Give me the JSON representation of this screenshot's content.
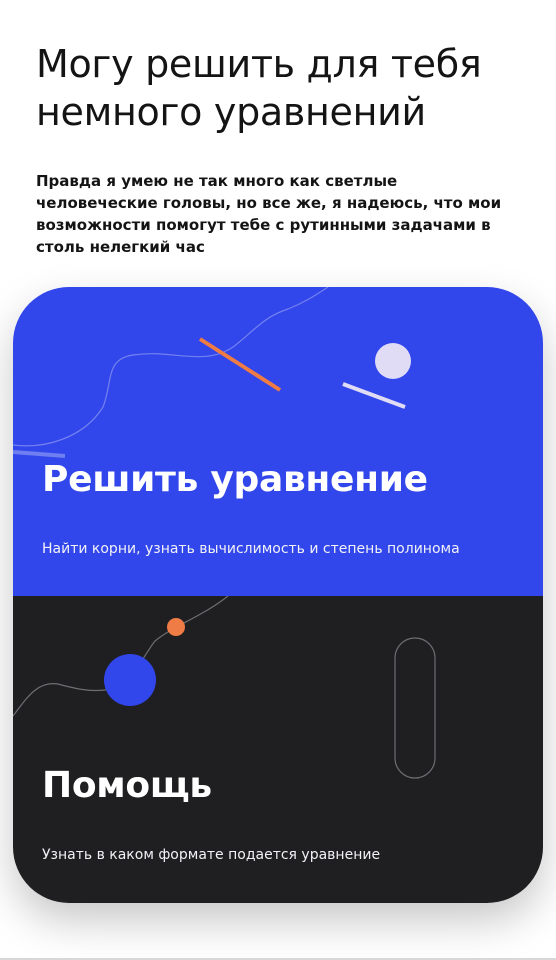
{
  "header": {
    "title": "Могу решить для тебя немного уравнений",
    "subtitle": "Правда я умею не так много как светлые человеческие головы, но все же, я надеюсь, что мои возможности помогут тебе с рутинными задачами в столь нелегкий час"
  },
  "cards": [
    {
      "title": "Решить уравнение",
      "description": "Найти корни, узнать вычислимость и степень полинома",
      "color": "#3146EB"
    },
    {
      "title": "Помощь",
      "description": "Узнать в каком формате подается уравнение",
      "color": "#1F1F21"
    }
  ],
  "colors": {
    "accent_orange": "#EF7B45",
    "accent_lilac": "#E0DCF5",
    "accent_blue": "#3146EB"
  }
}
